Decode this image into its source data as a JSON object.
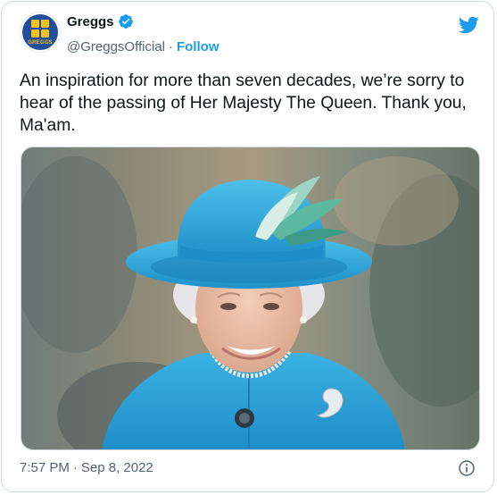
{
  "account": {
    "display_name": "Greggs",
    "handle": "@GreggsOfficial",
    "separator": "·",
    "follow_label": "Follow",
    "avatar_text": "GREGGS",
    "verified": true
  },
  "tweet": {
    "text": "An inspiration for more than seven decades, we’re sorry to hear of the passing of Her Majesty The Queen. Thank you, Ma'am.",
    "time": "7:57 PM",
    "date": "Sep 8, 2022",
    "separator": "·"
  },
  "colors": {
    "brand_blue": "#1d9bf0",
    "greggs_blue": "#1f4e9c",
    "greggs_yellow": "#f8c21a",
    "text_primary": "#0f1419",
    "text_secondary": "#536471"
  },
  "icons": {
    "platform": "twitter-bird-icon",
    "verified": "verified-badge-icon",
    "info": "info-icon"
  }
}
